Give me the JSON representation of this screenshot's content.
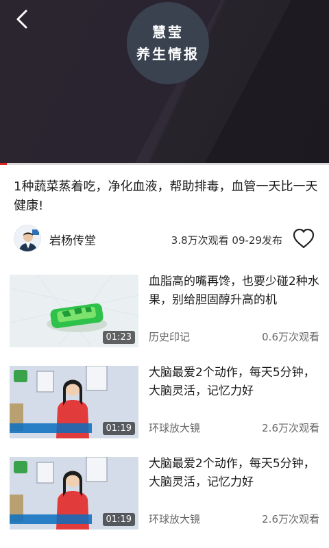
{
  "player": {
    "logo_line1": "慧莹",
    "logo_line2": "养生情报",
    "progress": 0.02,
    "back_icon": "chevron-left-icon"
  },
  "article": {
    "title": "1种蔬菜蒸着吃，净化血液，帮助排毒，血管一天比一天健康!",
    "author": "岩杨传堂",
    "meta": "3.8万次观看 09-29发布",
    "favorite_icon": "heart-outline-icon"
  },
  "related": [
    {
      "title": "血脂高的嘴再馋，也要少碰2种水果，别给胆固醇升高的机",
      "duration": "01:23",
      "source": "历史印记",
      "views": "0.6万次观看"
    },
    {
      "title": "大脑最爱2个动作，每天5分钟，大脑灵活，记忆力好",
      "duration": "01:19",
      "source": "环球放大镜",
      "views": "2.6万次观看"
    },
    {
      "title": "大脑最爱2个动作，每天5分钟，大脑灵活，记忆力好",
      "duration": "01:19",
      "source": "环球放大镜",
      "views": "2.6万次观看"
    }
  ],
  "colors": {
    "accent": "#e02020",
    "header_bg": "#2a2431",
    "logo_bg": "#3a4250"
  }
}
